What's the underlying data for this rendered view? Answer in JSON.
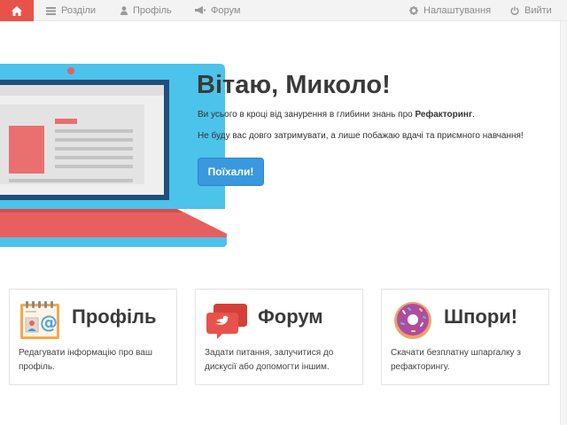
{
  "nav": {
    "sections": "Розділи",
    "profile": "Профіль",
    "forum": "Форум",
    "settings": "Налаштування",
    "logout": "Вийти"
  },
  "hero": {
    "title": "Вітаю, Миколо!",
    "line1_prefix": "Ви усього в кроці від занурення в глибини знань про ",
    "line1_bold": "Рефакторинг",
    "line1_suffix": ".",
    "line2": "Не буду вас довго затримувати, а лише побажаю вдачі та приємного навчання!",
    "button": "Поїхали!"
  },
  "cards": [
    {
      "title": "Профіль",
      "text": "Редагувати інформацію про ваш профіль."
    },
    {
      "title": "Форум",
      "text": "Задати питання, залучитися до дискусії або допомогти іншим."
    },
    {
      "title": "Шпори!",
      "text": "Скачати безплатну шпаргалку з рефакторингу."
    }
  ],
  "colors": {
    "accent": "#e7534b",
    "button": "#3a98de",
    "laptop_frame": "#4cc3ea",
    "laptop_base": "#e85f5f"
  }
}
